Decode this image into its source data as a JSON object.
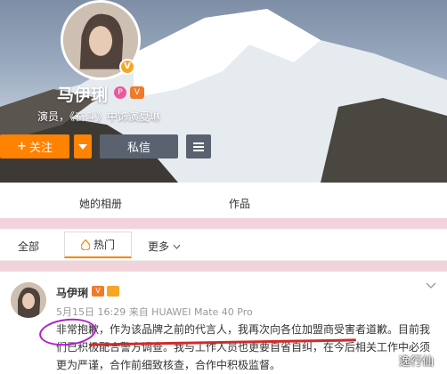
{
  "profile": {
    "name": "马伊琍",
    "subtitle": "演员，《奋斗》中饰演夏琳",
    "verified_badge": "V",
    "badge_p": "P",
    "badge_v": "V"
  },
  "actions": {
    "follow_label": "关注",
    "follow_plus": "+",
    "message_label": "私信"
  },
  "tabs": {
    "album": "她的相册",
    "works": "作品"
  },
  "filters": {
    "all": "全部",
    "hot": "热门",
    "more": "更多"
  },
  "post": {
    "name": "马伊琍",
    "meta": "5月15日 16:29 来自 HUAWEI Mate 40 Pro",
    "line1": "非常抱歉，作为该品牌之前的代言人，我再次向各位加盟商受害者道歉。目前我",
    "line2": "们已积极配合警方调查。我与工作人员也更要自省自纠，在今后相关工作中必须",
    "line3": "更为严谨，合作前细致核查，合作中积极监督。"
  },
  "watermark": "逸行仙",
  "colors": {
    "accent": "#ff8200",
    "button_dark": "#5a6270",
    "pink_divider": "#f3d3db",
    "circle_mark": "#b020c8",
    "underline_mark": "#d22a2a"
  }
}
